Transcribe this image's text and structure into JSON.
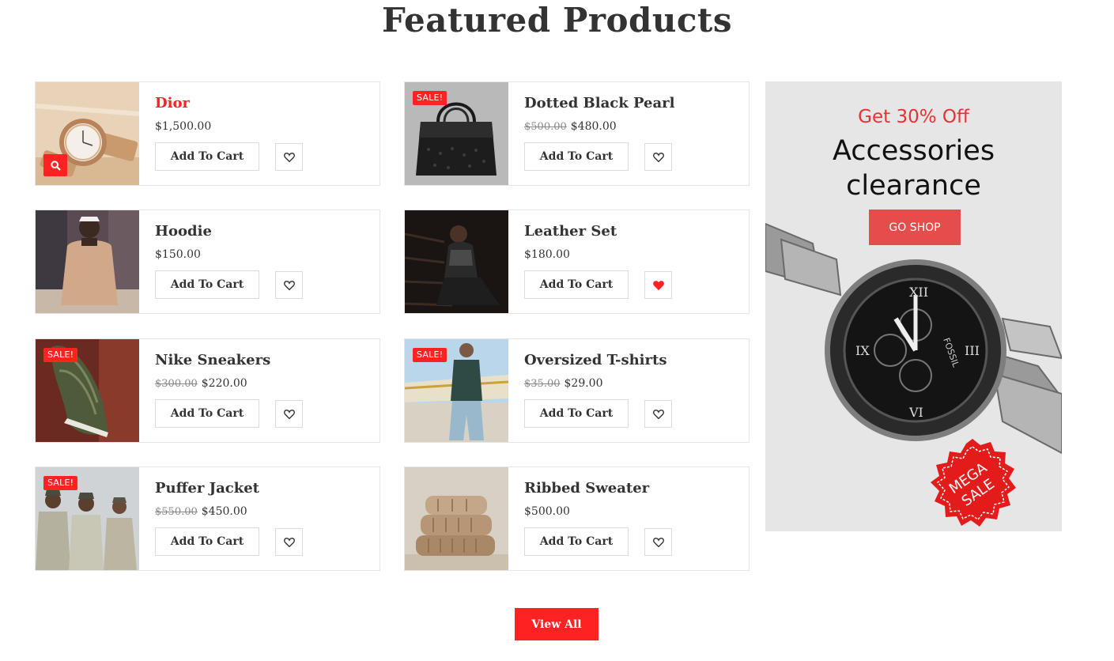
{
  "section": {
    "title": "Featured Products"
  },
  "cart_label": "Add To Cart",
  "sale_label": "SALE!",
  "products": [
    {
      "name": "Dior",
      "old_price": "",
      "price": "$1,500.00",
      "sale": false,
      "wishlisted": false,
      "highlight": true,
      "image_icon": "watch-image"
    },
    {
      "name": "Dotted Black Pearl",
      "old_price": "$500.00",
      "price": "$480.00",
      "sale": true,
      "wishlisted": false,
      "highlight": false,
      "image_icon": "handbag-image"
    },
    {
      "name": "Hoodie",
      "old_price": "",
      "price": "$150.00",
      "sale": false,
      "wishlisted": false,
      "highlight": false,
      "image_icon": "hoodie-model-image"
    },
    {
      "name": "Leather Set",
      "old_price": "",
      "price": "$180.00",
      "sale": false,
      "wishlisted": true,
      "highlight": false,
      "image_icon": "leather-set-model-image"
    },
    {
      "name": "Nike Sneakers",
      "old_price": "$300.00",
      "price": "$220.00",
      "sale": true,
      "wishlisted": false,
      "highlight": false,
      "image_icon": "sneaker-image"
    },
    {
      "name": "Oversized T-shirts",
      "old_price": "$35.00",
      "price": "$29.00",
      "sale": true,
      "wishlisted": false,
      "highlight": false,
      "image_icon": "tshirt-model-image"
    },
    {
      "name": "Puffer Jacket",
      "old_price": "$550.00",
      "price": "$450.00",
      "sale": true,
      "wishlisted": false,
      "highlight": false,
      "image_icon": "puffer-jacket-image"
    },
    {
      "name": "Ribbed Sweater",
      "old_price": "",
      "price": "$500.00",
      "sale": false,
      "wishlisted": false,
      "highlight": false,
      "image_icon": "sweater-stack-image"
    }
  ],
  "banner": {
    "offer": "Get 30% Off",
    "title_line1": "Accessories",
    "title_line2": "clearance",
    "button": "GO SHOP",
    "badge_line1": "MEGA",
    "badge_line2": "SALE",
    "watch_brand": "FOSSIL"
  },
  "view_all": "View All",
  "colors": {
    "accent": "#ff2222",
    "text": "#333333",
    "border": "#e5e5e5",
    "banner_bg": "#e6e6e6"
  }
}
